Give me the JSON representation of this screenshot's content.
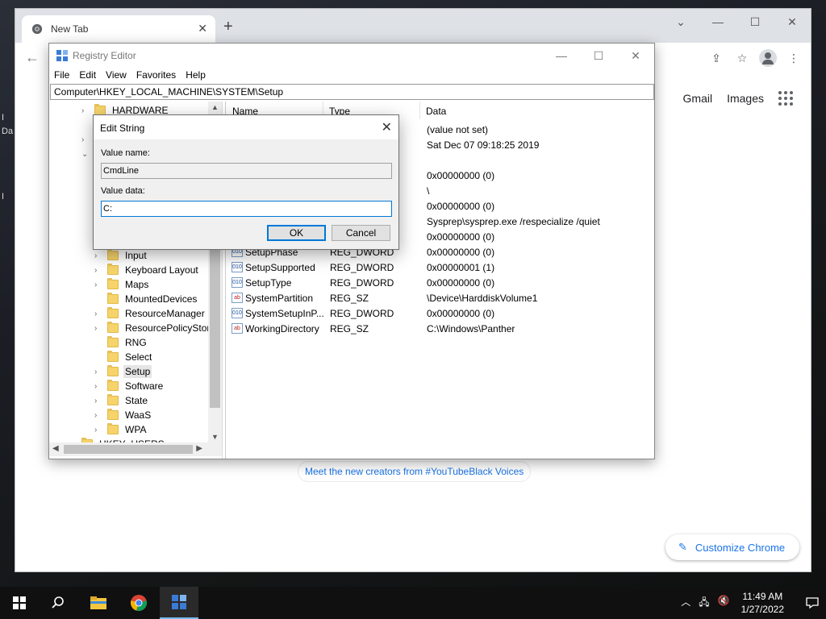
{
  "desktop": {
    "labels": [
      "I",
      "Da",
      "I"
    ]
  },
  "chrome": {
    "tab_title": "New Tab",
    "links": {
      "gmail": "Gmail",
      "images": "Images"
    },
    "promo": "Meet the new creators from #YouTubeBlack Voices",
    "customize": "Customize Chrome"
  },
  "regedit": {
    "title": "Registry Editor",
    "menu": [
      "File",
      "Edit",
      "View",
      "Favorites",
      "Help"
    ],
    "address": "Computer\\HKEY_LOCAL_MACHINE\\SYSTEM\\Setup",
    "tree": [
      {
        "label": "HARDWARE",
        "chev": "›"
      },
      {
        "label": "Input",
        "chev": "›"
      },
      {
        "label": "Keyboard Layout",
        "chev": "›"
      },
      {
        "label": "Maps",
        "chev": "›"
      },
      {
        "label": "MountedDevices",
        "chev": ""
      },
      {
        "label": "ResourceManager",
        "chev": "›"
      },
      {
        "label": "ResourcePolicyStore",
        "chev": "›"
      },
      {
        "label": "RNG",
        "chev": ""
      },
      {
        "label": "Select",
        "chev": ""
      },
      {
        "label": "Setup",
        "chev": "›"
      },
      {
        "label": "Software",
        "chev": "›"
      },
      {
        "label": "State",
        "chev": "›"
      },
      {
        "label": "WaaS",
        "chev": "›"
      },
      {
        "label": "WPA",
        "chev": "›"
      },
      {
        "label": "HKEY_USERS",
        "chev": "›"
      }
    ],
    "columns": {
      "name": "Name",
      "type": "Type",
      "data": "Data"
    },
    "rows": [
      {
        "name": "",
        "type": "",
        "data": "(value not set)",
        "icon": ""
      },
      {
        "name": "",
        "type": "",
        "data": "Sat Dec 07 09:18:25 2019",
        "icon": ""
      },
      {
        "name": "",
        "type": "",
        "data": "0x00000000 (0)",
        "icon": ""
      },
      {
        "name": "",
        "type": "",
        "data": "\\",
        "icon": ""
      },
      {
        "name": "",
        "type": "",
        "data": "0x00000000 (0)",
        "icon": ""
      },
      {
        "name": "",
        "type": "",
        "data": "Sysprep\\sysprep.exe /respecialize /quiet",
        "icon": ""
      },
      {
        "name": "",
        "type": "",
        "data": "0x00000000 (0)",
        "icon": ""
      },
      {
        "name": "SetupPhase",
        "type": "REG_DWORD",
        "data": "0x00000000 (0)",
        "icon": "dw"
      },
      {
        "name": "SetupSupported",
        "type": "REG_DWORD",
        "data": "0x00000001 (1)",
        "icon": "dw"
      },
      {
        "name": "SetupType",
        "type": "REG_DWORD",
        "data": "0x00000000 (0)",
        "icon": "dw"
      },
      {
        "name": "SystemPartition",
        "type": "REG_SZ",
        "data": "\\Device\\HarddiskVolume1",
        "icon": "ab"
      },
      {
        "name": "SystemSetupInP...",
        "type": "REG_DWORD",
        "data": "0x00000000 (0)",
        "icon": "dw"
      },
      {
        "name": "WorkingDirectory",
        "type": "REG_SZ",
        "data": "C:\\Windows\\Panther",
        "icon": "ab"
      }
    ]
  },
  "dialog": {
    "title": "Edit String",
    "value_name_label": "Value name:",
    "value_name": "CmdLine",
    "value_data_label": "Value data:",
    "value_data": "C:",
    "ok": "OK",
    "cancel": "Cancel"
  },
  "taskbar": {
    "time": "11:49 AM",
    "date": "1/27/2022"
  },
  "colors": {
    "accent": "#0078d7",
    "chrome_link": "#1a73e8"
  }
}
